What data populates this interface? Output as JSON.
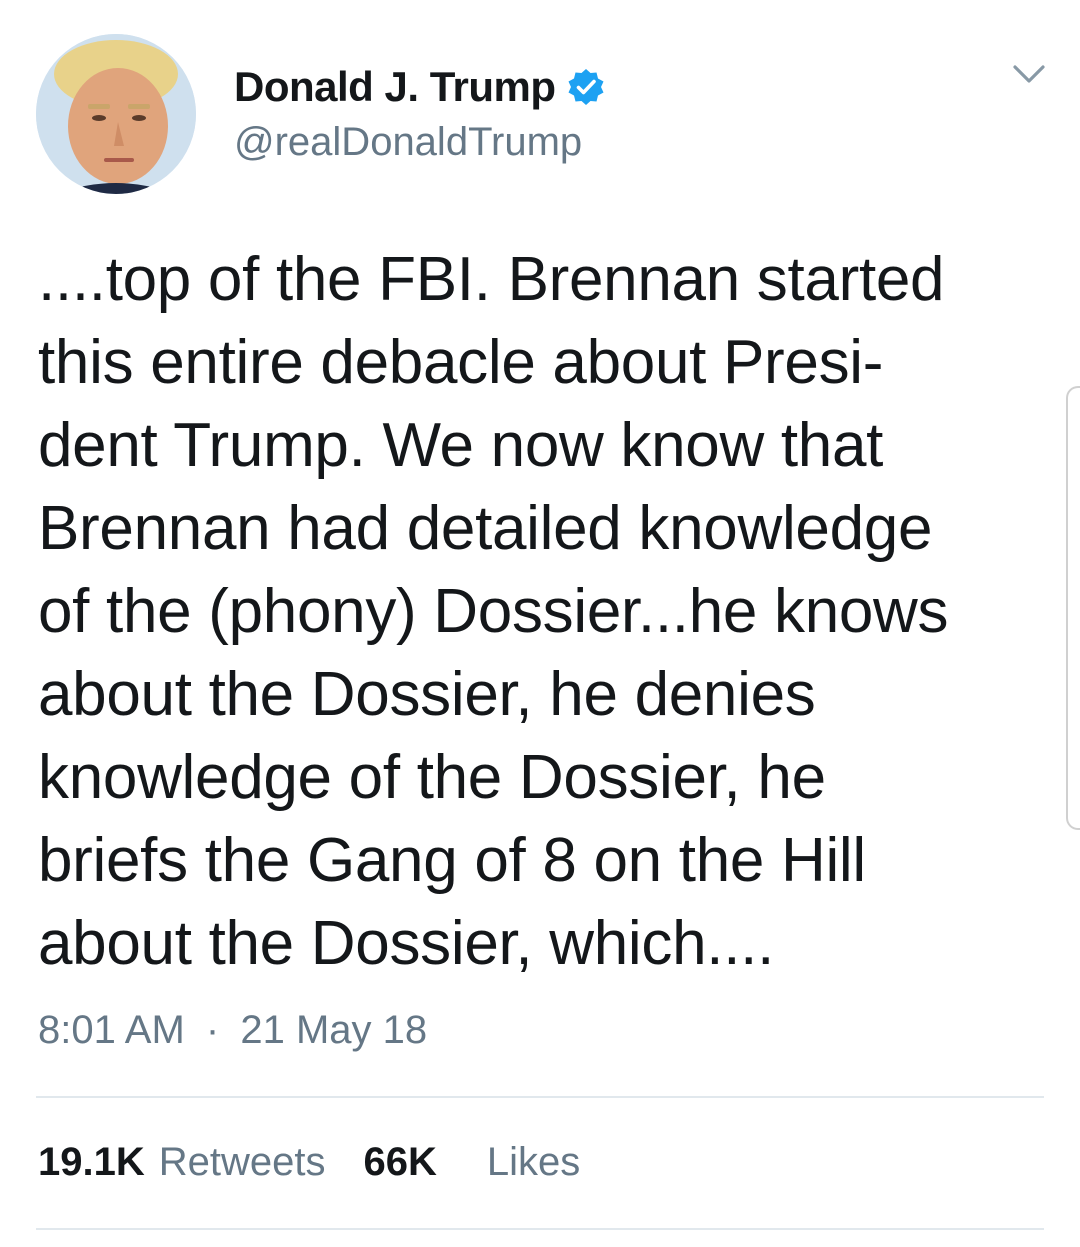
{
  "author": {
    "display_name": "Donald J. Trump",
    "handle": "@realDonaldTrump",
    "verified": true,
    "avatar_icon": "profile-photo",
    "verified_icon": "verified-badge-icon",
    "menu_icon": "chevron-down-icon"
  },
  "tweet": {
    "text": "....top of the FBI. Brennan started\nthis entire debacle about Presi-\ndent Trump. We now know that\nBrennan had detailed knowledge\nof the (phony) Dossier...he knows\nabout the Dossier, he denies\nknowledge of the Dossier, he\nbriefs the Gang of 8 on the Hill\nabout the Dossier, which....",
    "time": "8:01 AM",
    "separator": "·",
    "date": "21 May 18"
  },
  "stats": {
    "retweets_count": "19.1K",
    "retweets_label": "Retweets",
    "likes_count": "66K",
    "likes_label": "Likes"
  },
  "colors": {
    "text": "#14171a",
    "secondary": "#657786",
    "verified_blue": "#1da1f2",
    "divider": "#e1e8ed"
  }
}
